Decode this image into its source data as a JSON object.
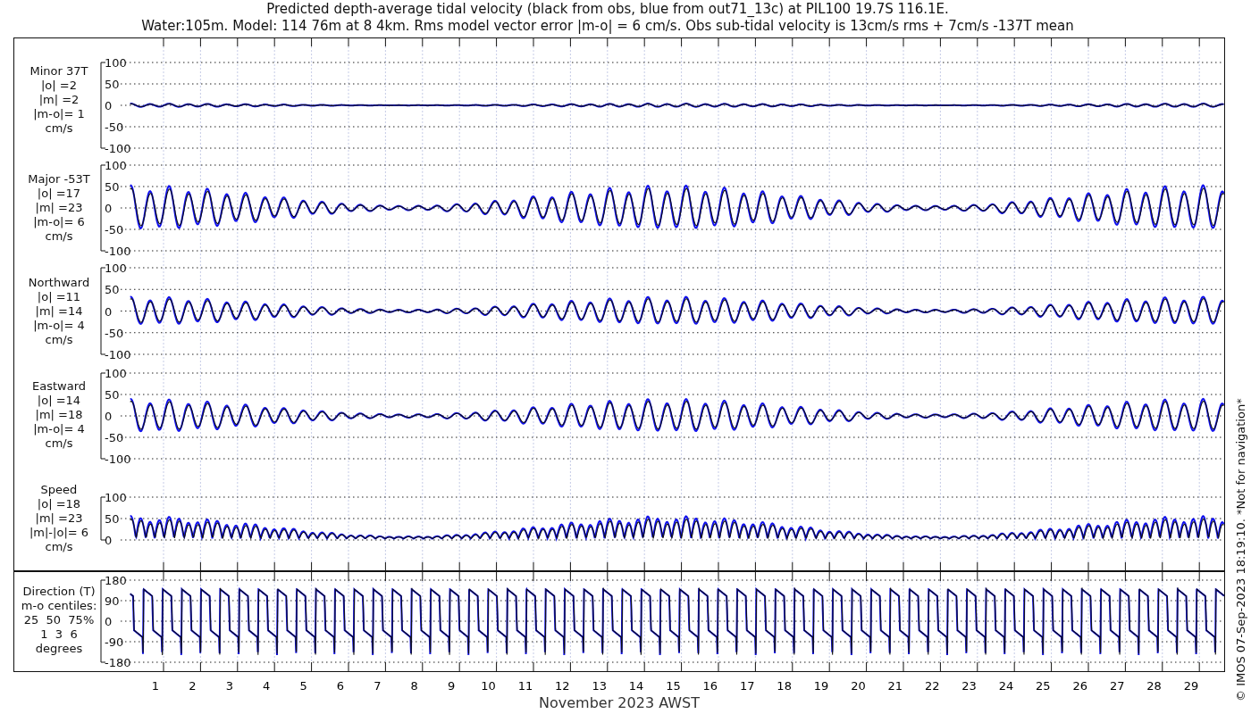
{
  "title": {
    "line_1": "Predicted depth-average tidal velocity (black from obs, blue from out71_13c) at PIL100 19.7S 116.1E.",
    "line_2": "Water:105m. Model: 114 76m at 8 4km. Rms model vector error |m-o| = 6 cm/s. Obs sub-tidal velocity is 13cm/s rms + 7cm/s -137T mean"
  },
  "panels": [
    {
      "kind": "velocity",
      "label": [
        "Minor 37T",
        "|o| =2",
        "|m| =2",
        "|m-o|= 1",
        "cm/s"
      ],
      "yticks": [
        "100",
        "50",
        "0",
        "-50",
        "-100"
      ]
    },
    {
      "kind": "velocity",
      "label": [
        "Major -53T",
        "|o| =17",
        "|m| =23",
        "|m-o|= 6",
        "cm/s"
      ],
      "yticks": [
        "100",
        "50",
        "0",
        "-50",
        "-100"
      ]
    },
    {
      "kind": "velocity",
      "label": [
        "Northward",
        "|o| =11",
        "|m| =14",
        "|m-o|= 4",
        "cm/s"
      ],
      "yticks": [
        "100",
        "50",
        "0",
        "-50",
        "-100"
      ]
    },
    {
      "kind": "velocity",
      "label": [
        "Eastward",
        "|o| =14",
        "|m| =18",
        "|m-o|= 4",
        "cm/s"
      ],
      "yticks": [
        "100",
        "50",
        "0",
        "-50",
        "-100"
      ]
    },
    {
      "kind": "speed",
      "label": [
        "Speed",
        "|o| =18",
        "|m| =23",
        "|m|-|o|= 6",
        "cm/s"
      ],
      "yticks": [
        "100",
        "50",
        "0"
      ]
    },
    {
      "kind": "direction",
      "label": [
        "Direction (T)",
        "m-o centiles:",
        "25  50  75%",
        "1  3  6",
        "degrees"
      ],
      "yticks": [
        "180",
        "90",
        "0",
        "-90",
        "-180"
      ]
    }
  ],
  "x_axis": {
    "tick_labels": [
      "1",
      "2",
      "3",
      "4",
      "5",
      "6",
      "7",
      "8",
      "9",
      "10",
      "11",
      "12",
      "13",
      "14",
      "15",
      "16",
      "17",
      "18",
      "19",
      "20",
      "21",
      "22",
      "23",
      "24",
      "25",
      "26",
      "27",
      "28",
      "29"
    ],
    "label": "November 2023 AWST"
  },
  "credit": "© IMOS 07-Sep-2023 18:19:10. *Not for navigation*"
}
